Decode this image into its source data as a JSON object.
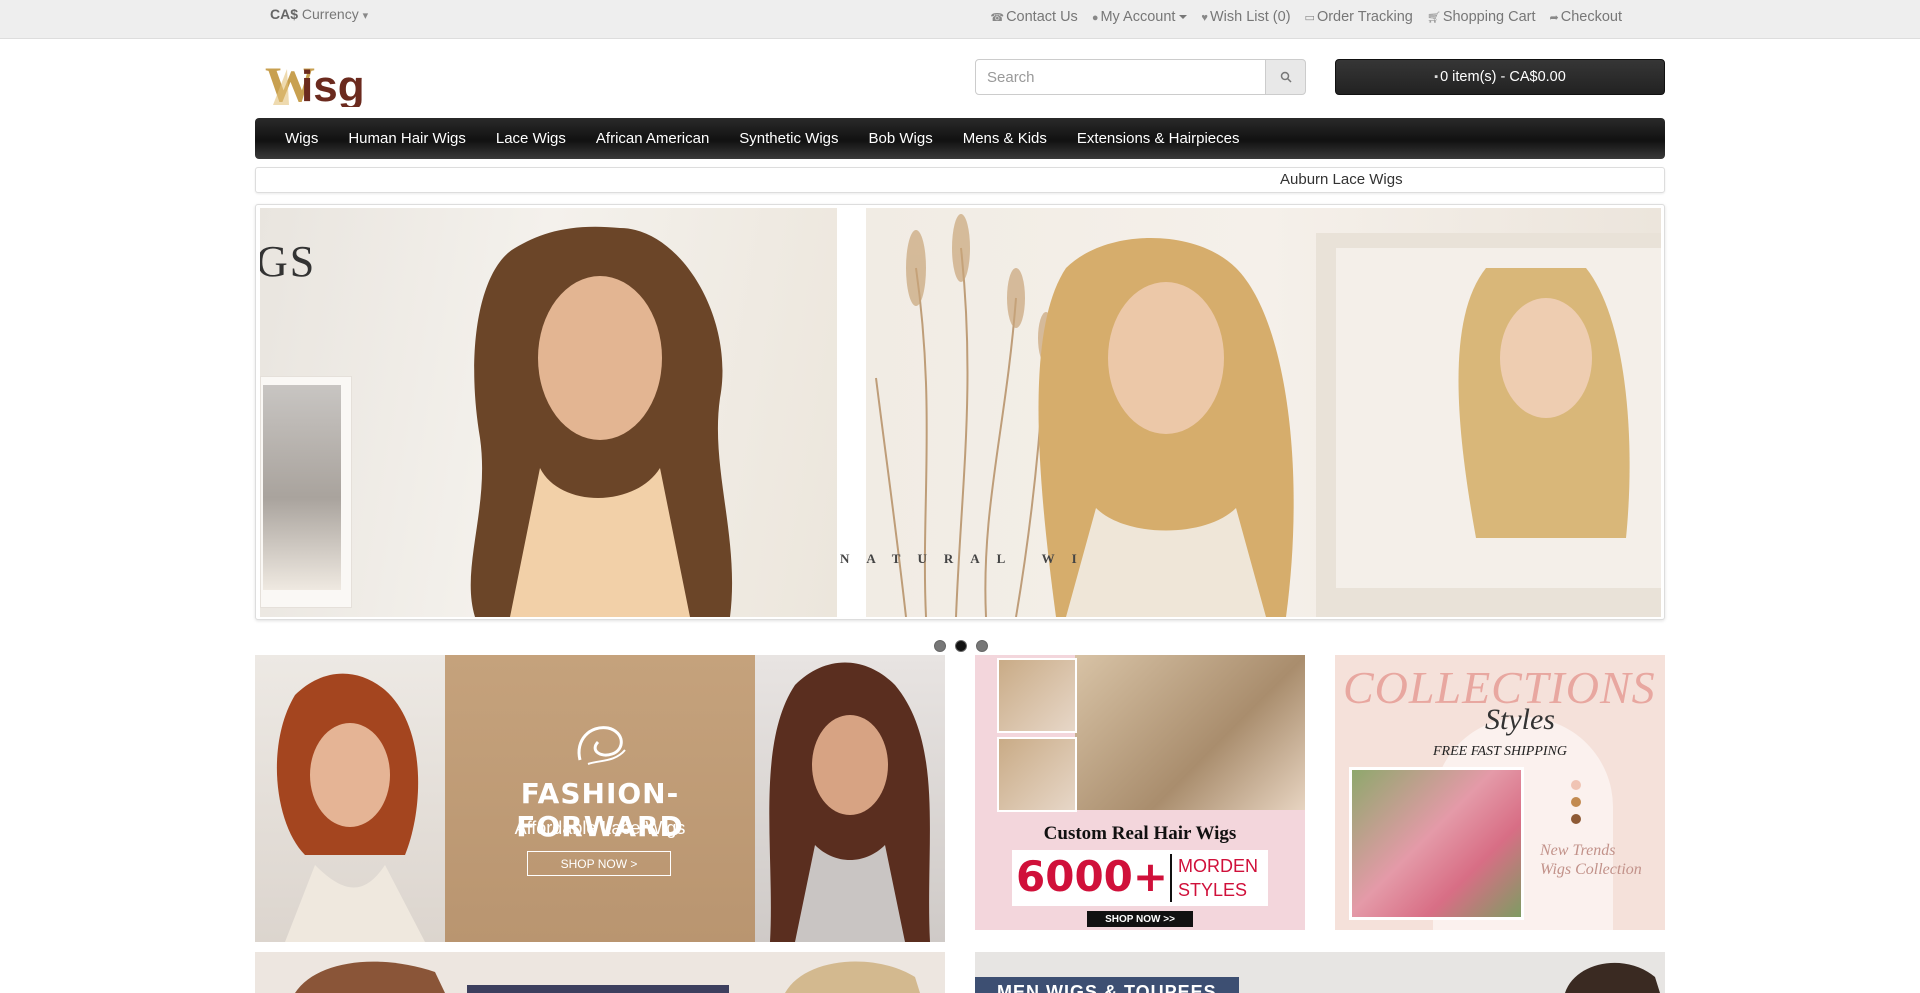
{
  "topbar": {
    "currency_code": "CA$",
    "currency_label": "Currency",
    "links": {
      "contact": "Contact Us",
      "account": "My Account",
      "wishlist": "Wish List (0)",
      "tracking": "Order Tracking",
      "cart": "Shopping Cart",
      "checkout": "Checkout"
    }
  },
  "header": {
    "logo_text": "Wisg",
    "search_placeholder": "Search",
    "cart_summary": "0 item(s) - CA$0.00"
  },
  "nav": {
    "items": [
      "Wigs",
      "Human Hair Wigs",
      "Lace Wigs",
      "African American",
      "Synthetic Wigs",
      "Bob Wigs",
      "Mens & Kids",
      "Extensions & Hairpieces"
    ]
  },
  "ticker": {
    "text": "Auburn Lace Wigs"
  },
  "slider": {
    "slide1_text": "GS",
    "slide2_text": "NATURAL WI",
    "active_dot": 2,
    "dot_count": 3
  },
  "banners": {
    "fashion": {
      "headline": "FASHION-FORWARD",
      "sub": "Affordable Lace Wigs",
      "cta": "SHOP NOW >"
    },
    "custom": {
      "title": "Custom Real Hair Wigs",
      "number": "6000+",
      "styles_line1": "MORDEN",
      "styles_line2": "STYLES",
      "cta": "SHOP NOW >>"
    },
    "collections": {
      "title": "COLLECTIONS",
      "script": "Styles",
      "shipping": "FREE FAST SHIPPING",
      "tag_line1": "New Trends",
      "tag_line2": "Wigs Collection"
    },
    "men": {
      "label": "MEN WIGS & TOUPEES"
    }
  },
  "colors": {
    "nav_bg": "#1a1a1a",
    "accent_red": "#d0103a",
    "logo_gold": "#c8a050",
    "logo_brown": "#6b2a1e"
  }
}
